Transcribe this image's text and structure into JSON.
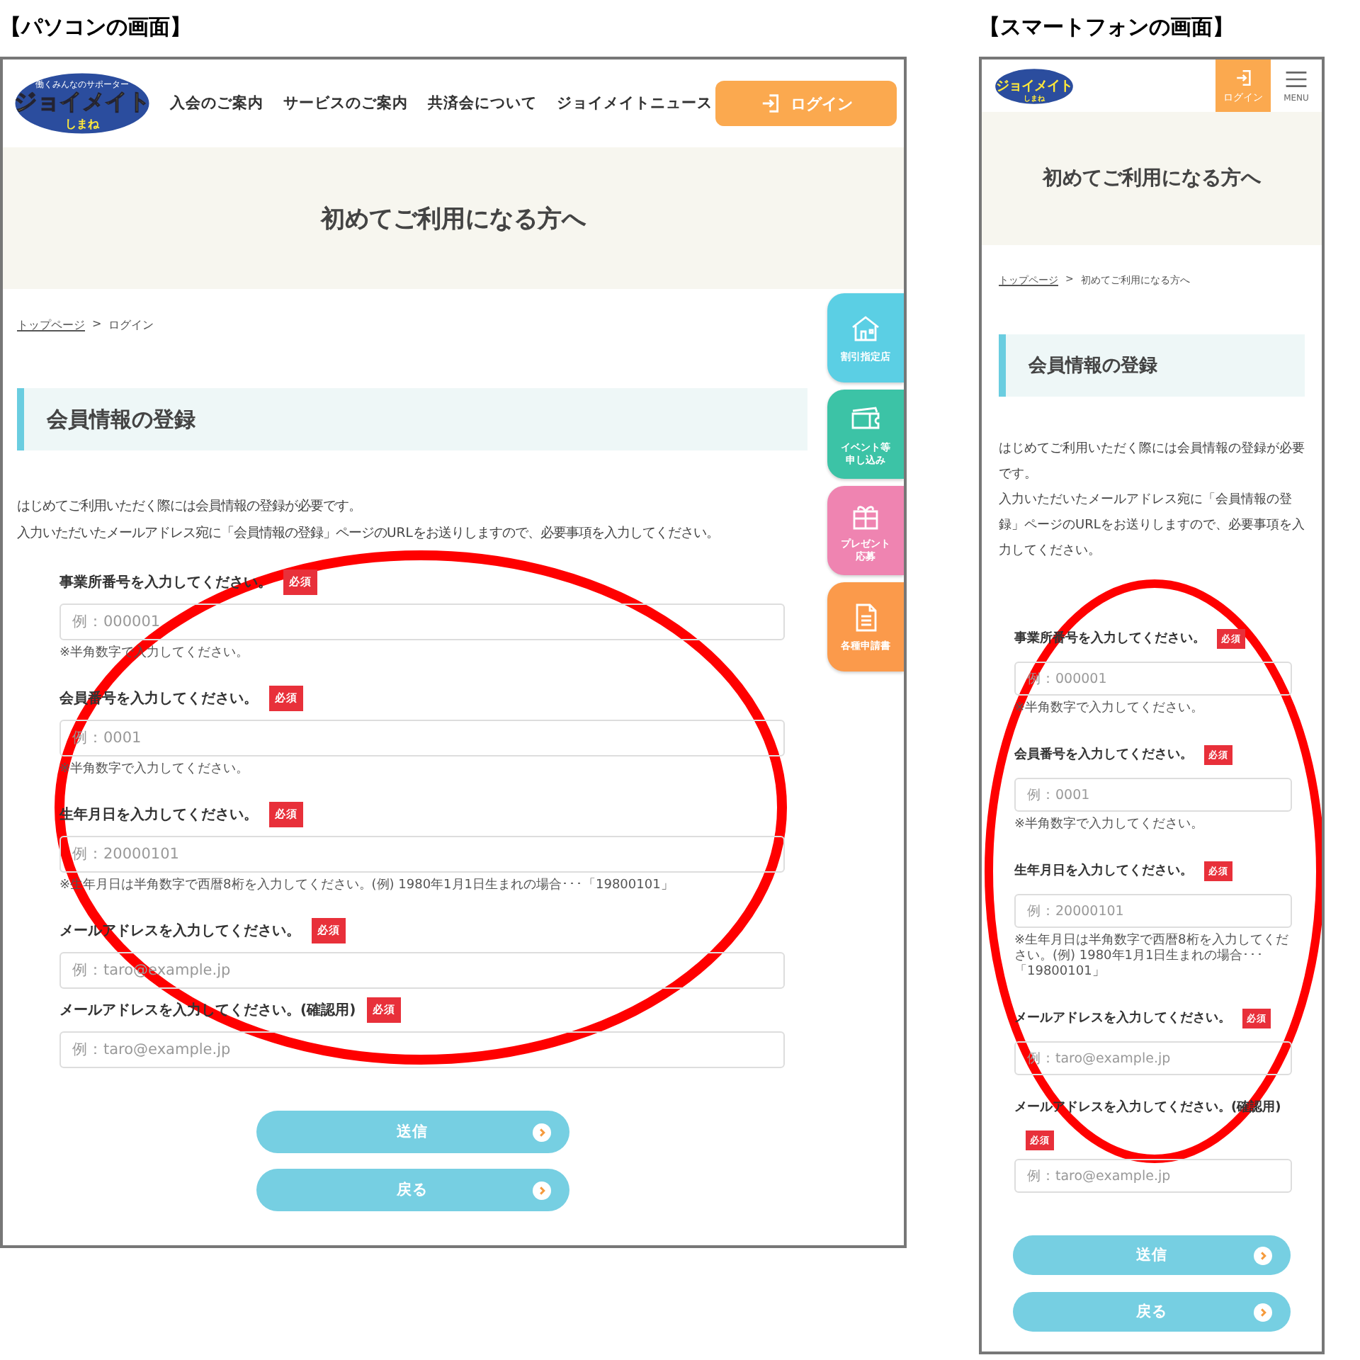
{
  "pc": {
    "caption": "【パソコンの画面】",
    "logo": {
      "tagline": "働くみんなのサポーター",
      "name": "ジョイメイト",
      "region": "しまね"
    },
    "nav": [
      "入会のご案内",
      "サービスのご案内",
      "共済会について",
      "ジョイメイトニュース"
    ],
    "login": "ログイン",
    "hero_title": "初めてご利用になる方へ",
    "breadcrumb": {
      "home": "トップページ",
      "separator": ">",
      "current": "ログイン"
    },
    "section_title": "会員情報の登録",
    "intro": [
      "はじめてご利用いただく際には会員情報の登録が必要です。",
      "入力いただいたメールアドレス宛に「会員情報の登録」ページのURLをお送りしますので、必要事項を入力してください。"
    ],
    "fields": [
      {
        "label": "事業所番号を入力してください。",
        "badge": "必須",
        "placeholder": "例：000001",
        "note": "※半角数字で入力してください。"
      },
      {
        "label": "会員番号を入力してください。",
        "badge": "必須",
        "placeholder": "例：0001",
        "note": "※半角数字で入力してください。"
      },
      {
        "label": "生年月日を入力してください。",
        "badge": "必須",
        "placeholder": "例：20000101",
        "note": "※生年月日は半角数字で西暦8桁を入力してください。(例) 1980年1月1日生まれの場合･･･「19800101」"
      },
      {
        "label": "メールアドレスを入力してください。",
        "badge": "必須",
        "placeholder": "例：taro@example.jp"
      },
      {
        "label": "メールアドレスを入力してください。(確認用)",
        "badge": "必須",
        "placeholder": "例：taro@example.jp"
      }
    ],
    "buttons": [
      "送信",
      "戻る"
    ],
    "side_tabs": [
      {
        "label": "割引指定店",
        "kind": "house",
        "color": "#5bcfe4"
      },
      {
        "label": "イベント等申し込み",
        "kind": "ticket",
        "color": "#3cc3a6"
      },
      {
        "label": "プレゼント応募",
        "kind": "gift",
        "color": "#ef84b1"
      },
      {
        "label": "各種申請書",
        "kind": "document",
        "color": "#fb9a4b"
      }
    ]
  },
  "sp": {
    "caption": "【スマートフォンの画面】",
    "logo": {
      "name": "ジョイメイト",
      "region": "しまね"
    },
    "login": "ログイン",
    "menu": "MENU",
    "hero_title": "初めてご利用になる方へ",
    "breadcrumb": {
      "home": "トップページ",
      "separator": ">",
      "current": "初めてご利用になる方へ"
    },
    "section_title": "会員情報の登録",
    "intro": [
      "はじめてご利用いただく際には会員情報の登録が必要です。",
      "入力いただいたメールアドレス宛に「会員情報の登録」ページのURLをお送りしますので、必要事項を入力してください。"
    ],
    "fields": [
      {
        "label": "事業所番号を入力してください。",
        "badge": "必須",
        "placeholder": "例：000001",
        "note": "※半角数字で入力してください。"
      },
      {
        "label": "会員番号を入力してください。",
        "badge": "必須",
        "placeholder": "例：0001",
        "note": "※半角数字で入力してください。"
      },
      {
        "label": "生年月日を入力してください。",
        "badge": "必須",
        "placeholder": "例：20000101",
        "note": "※生年月日は半角数字で西暦8桁を入力してください。(例) 1980年1月1日生まれの場合･･･「19800101」"
      },
      {
        "label": "メールアドレスを入力してください。",
        "badge": "必須",
        "placeholder": "例：taro@example.jp"
      },
      {
        "label": "メールアドレスを入力してください。(確認用)",
        "badge": "必須",
        "placeholder": "例：taro@example.jp"
      }
    ],
    "buttons": [
      "送信",
      "戻る"
    ]
  }
}
